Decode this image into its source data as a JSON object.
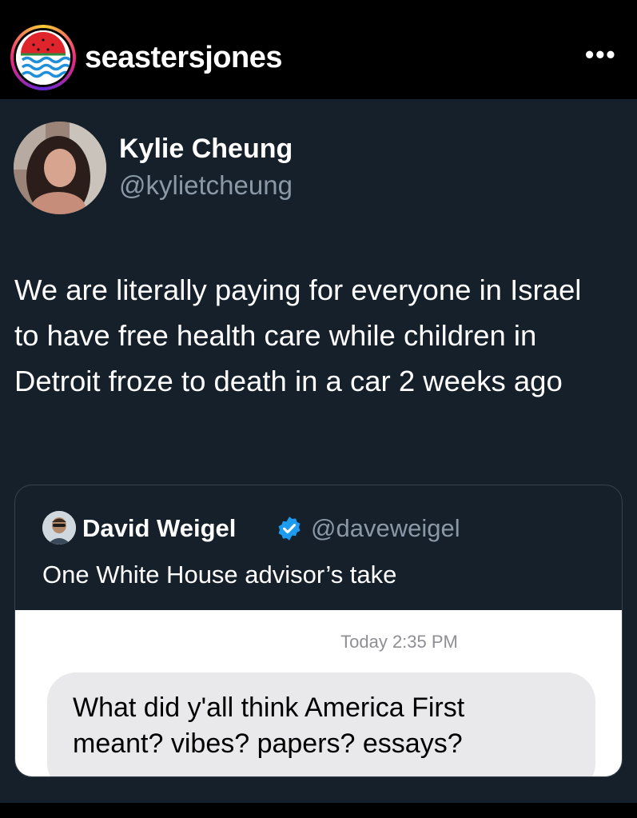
{
  "instagram": {
    "username": "seastersjones",
    "more_label": "..."
  },
  "tweet": {
    "author_name": "Kylie Cheung",
    "author_handle": "@kylietcheung",
    "text": "We are literally paying for everyone in Israel to have free health care while children in Detroit froze to death in a car 2 weeks ago"
  },
  "quoted": {
    "author_name": "David Weigel",
    "author_handle": "@daveweigel",
    "text": "One White House advisor’s take",
    "verified_icon": "verified-badge-icon",
    "image": {
      "timestamp": "Today 2:35 PM",
      "message": "What did y'all think America First meant? vibes? papers? essays?"
    }
  },
  "colors": {
    "card_bg": "#15202b",
    "secondary_text": "#8b98a5",
    "verified_blue": "#1d9bf0",
    "message_bubble": "#e9e9eb"
  }
}
